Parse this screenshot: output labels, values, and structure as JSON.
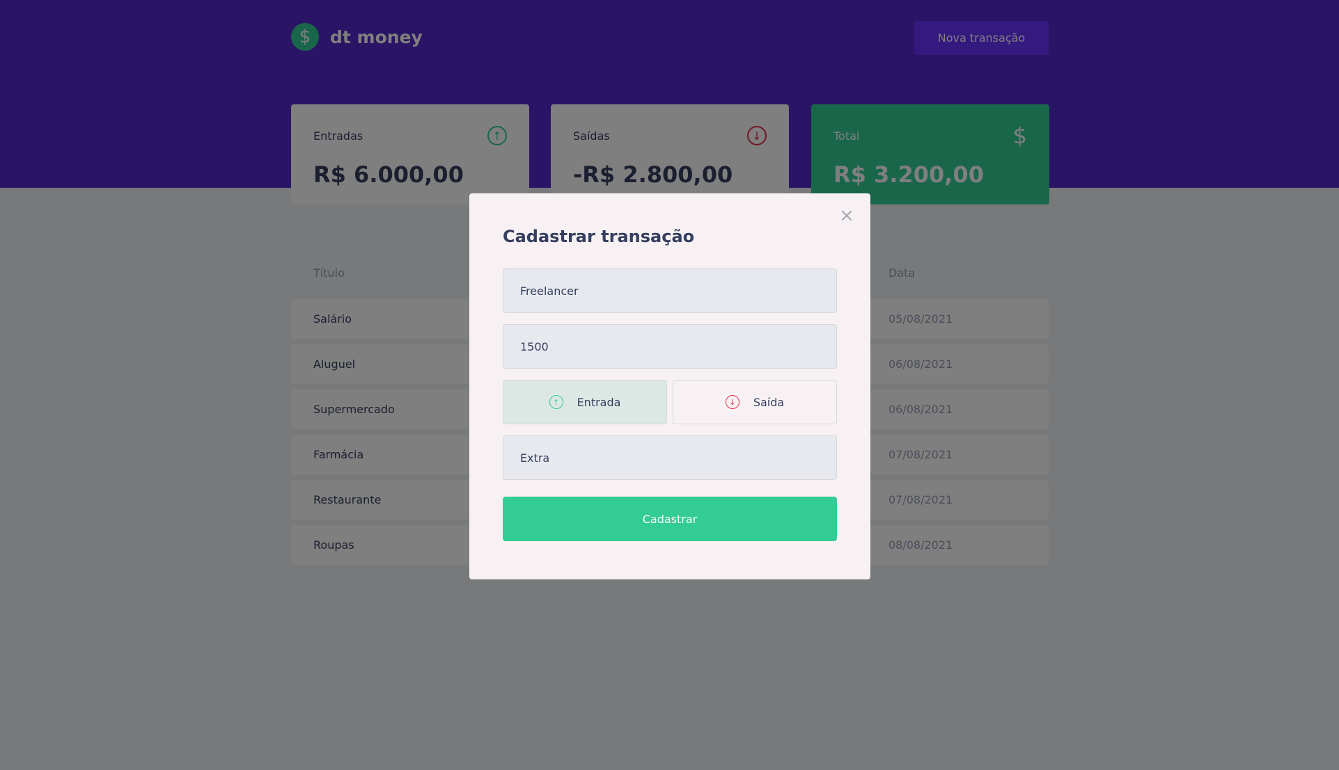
{
  "app": {
    "name": "dt money",
    "new_transaction_label": "Nova transação"
  },
  "summary": {
    "income": {
      "label": "Entradas",
      "value": "R$ 6.000,00"
    },
    "outcome": {
      "label": "Saídas",
      "value": "-R$ 2.800,00"
    },
    "total": {
      "label": "Total",
      "value": "R$ 3.200,00"
    }
  },
  "table": {
    "headers": {
      "title": "Título",
      "date": "Data"
    },
    "rows": [
      {
        "title": "Salário",
        "date": "05/08/2021"
      },
      {
        "title": "Aluguel",
        "date": "06/08/2021"
      },
      {
        "title": "Supermercado",
        "date": "06/08/2021"
      },
      {
        "title": "Farmácia",
        "date": "07/08/2021"
      },
      {
        "title": "Restaurante",
        "date": "07/08/2021"
      },
      {
        "title": "Roupas",
        "date": "08/08/2021"
      }
    ]
  },
  "modal": {
    "title": "Cadastrar transação",
    "close_icon": "×",
    "title_value": "Freelancer",
    "amount_value": "1500",
    "income_label": "Entrada",
    "outcome_label": "Saída",
    "category_value": "Extra",
    "submit_label": "Cadastrar",
    "selected_type": "Entrada"
  },
  "icons": {
    "logo": "dollar-icon",
    "income": "arrow-up-circle-icon",
    "outcome": "arrow-down-circle-icon",
    "total": "dollar-icon",
    "close": "close-icon"
  },
  "colors": {
    "header": "#5429cc",
    "button": "#6933ff",
    "green": "#33cc95",
    "red": "#e52e4d",
    "background": "#f0f2f5"
  }
}
